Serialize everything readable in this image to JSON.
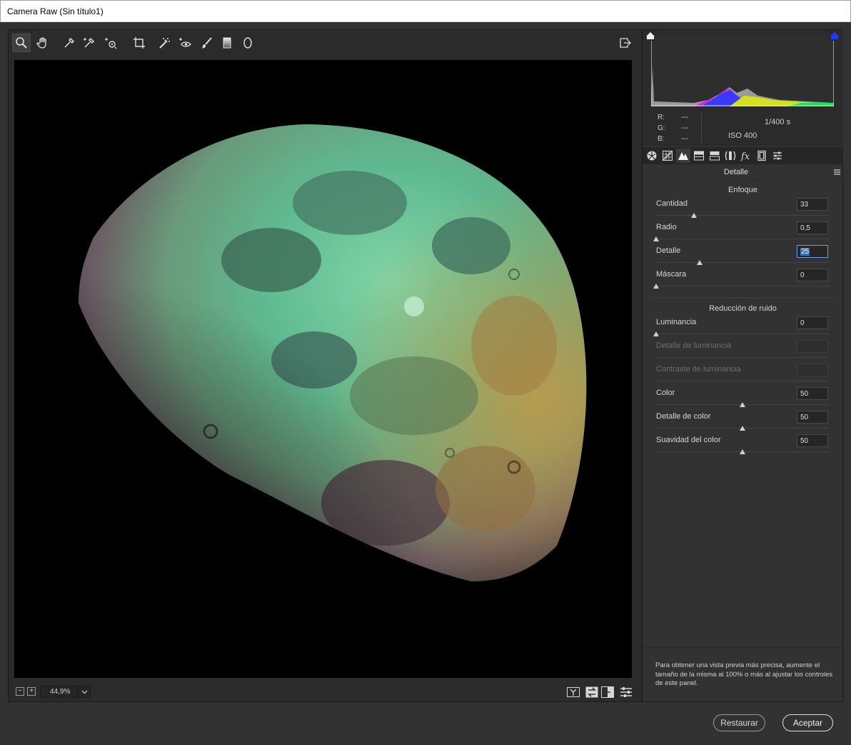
{
  "window": {
    "title": "Camera Raw (Sin título1)"
  },
  "toolbar": {
    "tools": [
      "zoom-icon",
      "hand-icon",
      "white-balance-icon",
      "color-sampler-icon",
      "targeted-adjust-icon",
      "crop-icon",
      "spot-removal-icon",
      "red-eye-icon",
      "brush-icon",
      "graduated-filter-icon",
      "radial-filter-icon"
    ],
    "active": "zoom-icon"
  },
  "zoom": {
    "value": "44,9%"
  },
  "histogram": {
    "r_label": "R:",
    "g_label": "G:",
    "b_label": "B:",
    "r_value": "---",
    "g_value": "---",
    "b_value": "---",
    "shutter": "1/400 s",
    "iso": "ISO 400"
  },
  "panel": {
    "title": "Detalle",
    "sharpening": {
      "title": "Enfoque",
      "sliders": [
        {
          "label": "Cantidad",
          "value": "33",
          "fraction": 0.22
        },
        {
          "label": "Radio",
          "value": "0,5",
          "fraction": 0.0
        },
        {
          "label": "Detalle",
          "value": "25",
          "fraction": 0.25
        },
        {
          "label": "Máscara",
          "value": "0",
          "fraction": 0.0
        }
      ]
    },
    "noise": {
      "title": "Reducción de ruido",
      "sliders": [
        {
          "label": "Luminancia",
          "value": "0",
          "fraction": 0.0
        },
        {
          "label": "Detalle de luminancia",
          "value": ""
        },
        {
          "label": "Contraste de luminancia",
          "value": ""
        },
        {
          "label": "Color",
          "value": "50",
          "fraction": 0.5
        },
        {
          "label": "Detalle de color",
          "value": "50",
          "fraction": 0.5
        },
        {
          "label": "Suavidad del color",
          "value": "50",
          "fraction": 0.5
        }
      ]
    },
    "note": "Para obtener una vista previa más precisa, aumente el tamaño de la misma al 100% o más al ajustar los controles de este panel."
  },
  "buttons": {
    "restore": "Restaurar",
    "accept": "Aceptar"
  },
  "colors": {
    "accent": "#2f6cd4",
    "bg": "#323232"
  }
}
